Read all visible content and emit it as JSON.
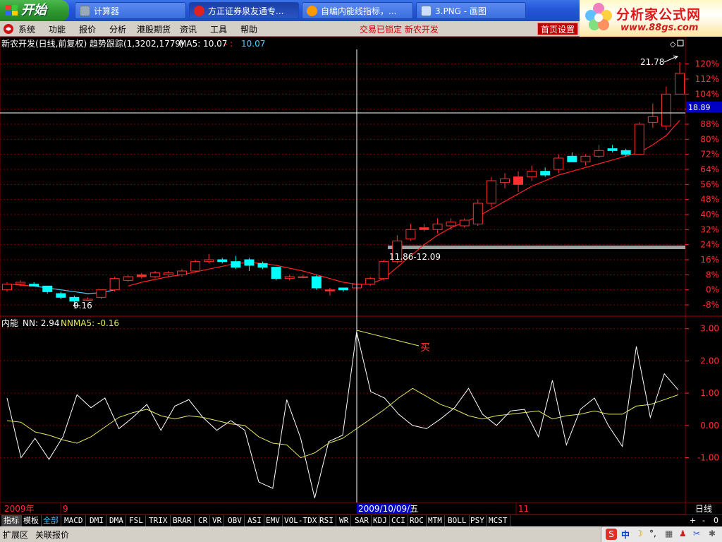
{
  "taskbar": {
    "start_label": "开始",
    "tasks": [
      {
        "label": "计算器",
        "active": false
      },
      {
        "label": "方正证券泉友通专...",
        "active": true
      },
      {
        "label": "自编内能线指标，...",
        "active": false
      },
      {
        "label": "3.PNG - 画图",
        "active": false
      }
    ]
  },
  "logo": {
    "title": "分析家公式网",
    "url": "www.88gs.com"
  },
  "menu": {
    "items": [
      "系统",
      "功能",
      "报价",
      "分析",
      "港股期货",
      "资讯",
      "工具",
      "帮助"
    ],
    "status": "交易已锁定  新农开发",
    "home_button": "首页设置"
  },
  "main_panel": {
    "header_name": "新农开发(日线,前复权) 趋势跟踪(1,3202,1779)",
    "ma_label": "MA5: 10.07",
    "ma_value": "10.07",
    "ma_sep": " - : ",
    "crosshair_price": "18.89",
    "high_label": "21.78",
    "low_label": "9.16",
    "band_label": "11.86-12.09"
  },
  "sub_panel": {
    "indicator_name": "内能",
    "nn_label": "NN: 2.94",
    "nnma_label": "NNMA5: -0.16",
    "buy_label": "买"
  },
  "x_axis": {
    "year": "2009年",
    "month_9": "9",
    "cursor_date": "2009/10/09/五",
    "month_11": "11",
    "period": "日线"
  },
  "bottom_tabs": [
    "指标",
    "模板",
    "全部",
    "MACD",
    "DMI",
    "DMA",
    "FSL",
    "TRIX",
    "BRAR",
    "CR",
    "VR",
    "OBV",
    "ASI",
    "EMV",
    "VOL-TDX",
    "RSI",
    "WR",
    "SAR",
    "KDJ",
    "CCI",
    "ROC",
    "MTM",
    "BOLL",
    "PSY",
    "MCST"
  ],
  "bottom_bar": {
    "expand": "扩展区",
    "related": "关联报价",
    "plus": "+",
    "minus": "-",
    "zero": "0"
  },
  "colors": {
    "up": "#ff3030",
    "down": "#00ffff",
    "ma": "#ff2020",
    "ma_down": "#40d0ff",
    "nn": "#ffffff",
    "nnma": "#e8e860",
    "grid": "#800000",
    "axis_text": "#ff3030"
  },
  "chart_data": [
    {
      "type": "candlestick",
      "title": "新农开发(日线,前复权)",
      "y_axis_ticks": [
        "120%",
        "112%",
        "104%",
        "96%",
        "88%",
        "80%",
        "72%",
        "64%",
        "56%",
        "48%",
        "40%",
        "32%",
        "24%",
        "16%",
        "8%",
        "0%",
        "-8%"
      ],
      "ylim": [
        -11,
        124
      ],
      "candles": [
        {
          "o": 0,
          "h": 4,
          "l": -1,
          "c": 3
        },
        {
          "o": 3,
          "h": 5,
          "l": 2,
          "c": 4
        },
        {
          "o": 3,
          "h": 4,
          "l": 2,
          "c": 2
        },
        {
          "o": 2,
          "h": 2,
          "l": -2,
          "c": -1
        },
        {
          "o": -2,
          "h": -1,
          "l": -5,
          "c": -4
        },
        {
          "o": -4,
          "h": -3,
          "l": -7,
          "c": -6
        },
        {
          "o": -5,
          "h": -4,
          "l": -6,
          "c": -5
        },
        {
          "o": -4,
          "h": 0,
          "l": -5,
          "c": 0
        },
        {
          "o": 0,
          "h": 7,
          "l": -1,
          "c": 6
        },
        {
          "o": 5,
          "h": 8,
          "l": 4,
          "c": 7
        },
        {
          "o": 7,
          "h": 9,
          "l": 6,
          "c": 8
        },
        {
          "o": 7,
          "h": 10,
          "l": 6,
          "c": 9
        },
        {
          "o": 8,
          "h": 10,
          "l": 7,
          "c": 9
        },
        {
          "o": 8,
          "h": 11,
          "l": 7,
          "c": 10
        },
        {
          "o": 10,
          "h": 16,
          "l": 9,
          "c": 15
        },
        {
          "o": 15,
          "h": 19,
          "l": 14,
          "c": 16
        },
        {
          "o": 16,
          "h": 17,
          "l": 14,
          "c": 15
        },
        {
          "o": 15,
          "h": 18,
          "l": 11,
          "c": 12
        },
        {
          "o": 16,
          "h": 17,
          "l": 10,
          "c": 13
        },
        {
          "o": 14,
          "h": 15,
          "l": 11,
          "c": 12
        },
        {
          "o": 12,
          "h": 12,
          "l": 5,
          "c": 6
        },
        {
          "o": 6,
          "h": 8,
          "l": 5,
          "c": 7
        },
        {
          "o": 7,
          "h": 8,
          "l": 6,
          "c": 7
        },
        {
          "o": 7,
          "h": 8,
          "l": 0,
          "c": 1
        },
        {
          "o": 0,
          "h": 1,
          "l": -3,
          "c": 0
        },
        {
          "o": 1,
          "h": 1,
          "l": -1,
          "c": 0
        },
        {
          "o": 1,
          "h": 3,
          "l": 0,
          "c": 3
        },
        {
          "o": 3,
          "h": 7,
          "l": 2,
          "c": 6
        },
        {
          "o": 6,
          "h": 16,
          "l": 5,
          "c": 15
        },
        {
          "o": 15,
          "h": 29,
          "l": 14,
          "c": 26
        },
        {
          "o": 27,
          "h": 35,
          "l": 26,
          "c": 32
        },
        {
          "o": 32,
          "h": 35,
          "l": 31,
          "c": 33
        },
        {
          "o": 32,
          "h": 38,
          "l": 30,
          "c": 35
        },
        {
          "o": 34,
          "h": 38,
          "l": 32,
          "c": 36
        },
        {
          "o": 34,
          "h": 38,
          "l": 33,
          "c": 37
        },
        {
          "o": 35,
          "h": 48,
          "l": 34,
          "c": 46
        },
        {
          "o": 46,
          "h": 60,
          "l": 44,
          "c": 58
        },
        {
          "o": 57,
          "h": 62,
          "l": 54,
          "c": 59
        },
        {
          "o": 56,
          "h": 63,
          "l": 52,
          "c": 60
        },
        {
          "o": 60,
          "h": 66,
          "l": 58,
          "c": 63
        },
        {
          "o": 63,
          "h": 65,
          "l": 60,
          "c": 61
        },
        {
          "o": 64,
          "h": 72,
          "l": 62,
          "c": 70
        },
        {
          "o": 71,
          "h": 73,
          "l": 68,
          "c": 68
        },
        {
          "o": 68,
          "h": 72,
          "l": 66,
          "c": 71
        },
        {
          "o": 71,
          "h": 77,
          "l": 70,
          "c": 74
        },
        {
          "o": 75,
          "h": 77,
          "l": 73,
          "c": 74
        },
        {
          "o": 74,
          "h": 75,
          "l": 71,
          "c": 72
        },
        {
          "o": 72,
          "h": 89,
          "l": 72,
          "c": 88
        },
        {
          "o": 89,
          "h": 99,
          "l": 86,
          "c": 92
        },
        {
          "o": 87,
          "h": 108,
          "l": 85,
          "c": 104
        },
        {
          "o": 104,
          "h": 121,
          "l": 104,
          "c": 115
        }
      ],
      "ma_up": [
        3,
        2.5,
        2,
        1,
        0,
        -1,
        -2,
        -1.5,
        0,
        2,
        4,
        5.5,
        7,
        8,
        9.5,
        11,
        12.5,
        14,
        14.5,
        14,
        13,
        11.5,
        10,
        8,
        6,
        4,
        3,
        3,
        6,
        12,
        18,
        24,
        29,
        33,
        36,
        39,
        43,
        47,
        51,
        55,
        58,
        61,
        63,
        65,
        67,
        69,
        71,
        73,
        77,
        82,
        90
      ],
      "ma_down_range": [
        2,
        8,
        16,
        26
      ]
    },
    {
      "type": "line",
      "title": "内能",
      "y_axis_ticks": [
        "3.00",
        "2.00",
        "1.00",
        "0.00",
        "-1.00"
      ],
      "ylim": [
        -2.3,
        3.3
      ],
      "series": [
        {
          "name": "NN",
          "values": [
            0.85,
            -1.0,
            -0.4,
            -1.05,
            -0.35,
            0.95,
            0.55,
            0.85,
            -0.1,
            0.25,
            0.65,
            -0.15,
            0.6,
            0.8,
            0.25,
            -0.15,
            0.15,
            -0.15,
            -1.75,
            -1.95,
            0.8,
            -0.4,
            -2.25,
            -0.5,
            -0.3,
            2.9,
            1.05,
            0.85,
            0.35,
            0.0,
            -0.1,
            0.2,
            0.55,
            1.15,
            0.35,
            0.0,
            0.45,
            0.5,
            -0.35,
            1.4,
            -0.6,
            0.5,
            0.85,
            0.0,
            -0.65,
            2.45,
            0.25,
            1.6,
            1.1
          ]
        },
        {
          "name": "NNMA5",
          "values": [
            0.15,
            0.1,
            -0.2,
            -0.3,
            -0.45,
            -0.55,
            -0.35,
            -0.05,
            0.25,
            0.4,
            0.5,
            0.3,
            0.2,
            0.3,
            0.25,
            0.15,
            0.05,
            0.0,
            -0.35,
            -0.55,
            -0.6,
            -1.0,
            -0.85,
            -0.55,
            -0.4,
            -0.1,
            0.2,
            0.5,
            0.85,
            1.15,
            0.9,
            0.65,
            0.5,
            0.3,
            0.2,
            0.3,
            0.35,
            0.4,
            0.45,
            0.2,
            0.3,
            0.35,
            0.45,
            0.35,
            0.35,
            0.6,
            0.65,
            0.8,
            0.95
          ]
        }
      ]
    }
  ]
}
